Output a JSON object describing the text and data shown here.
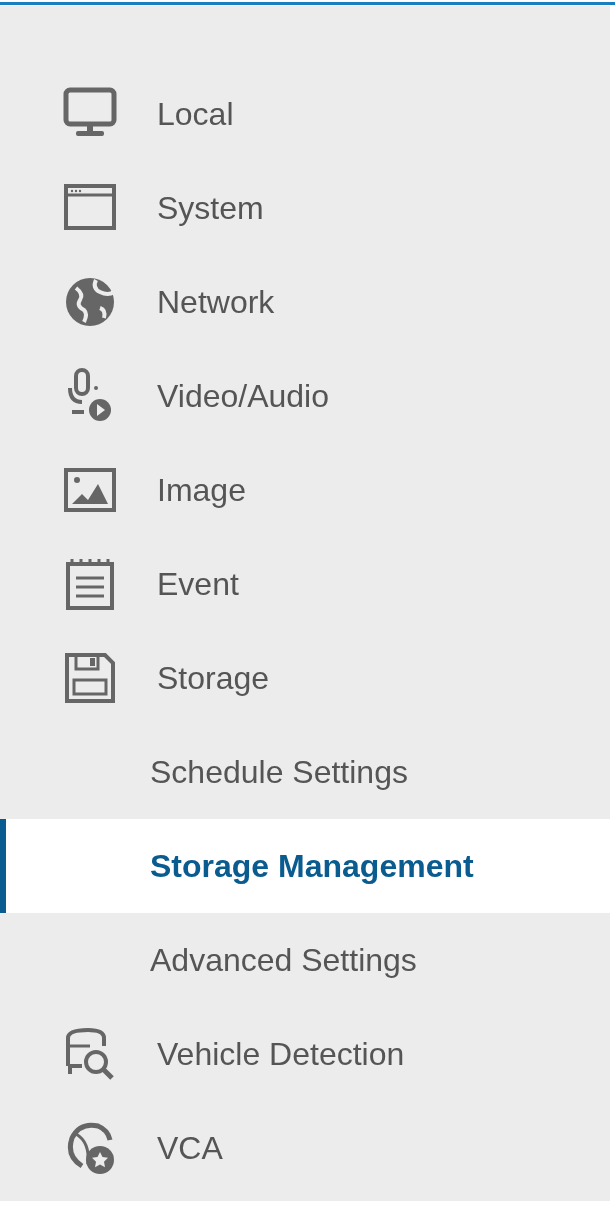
{
  "sidebar": {
    "items": [
      {
        "label": "Local",
        "selected": false
      },
      {
        "label": "System",
        "selected": false
      },
      {
        "label": "Network",
        "selected": false
      },
      {
        "label": "Video/Audio",
        "selected": false
      },
      {
        "label": "Image",
        "selected": false
      },
      {
        "label": "Event",
        "selected": false
      },
      {
        "label": "Storage",
        "selected": false,
        "children": [
          {
            "label": "Schedule Settings",
            "selected": false
          },
          {
            "label": "Storage Management",
            "selected": true
          },
          {
            "label": "Advanced Settings",
            "selected": false
          }
        ]
      },
      {
        "label": "Vehicle Detection",
        "selected": false
      },
      {
        "label": "VCA",
        "selected": false
      }
    ]
  }
}
